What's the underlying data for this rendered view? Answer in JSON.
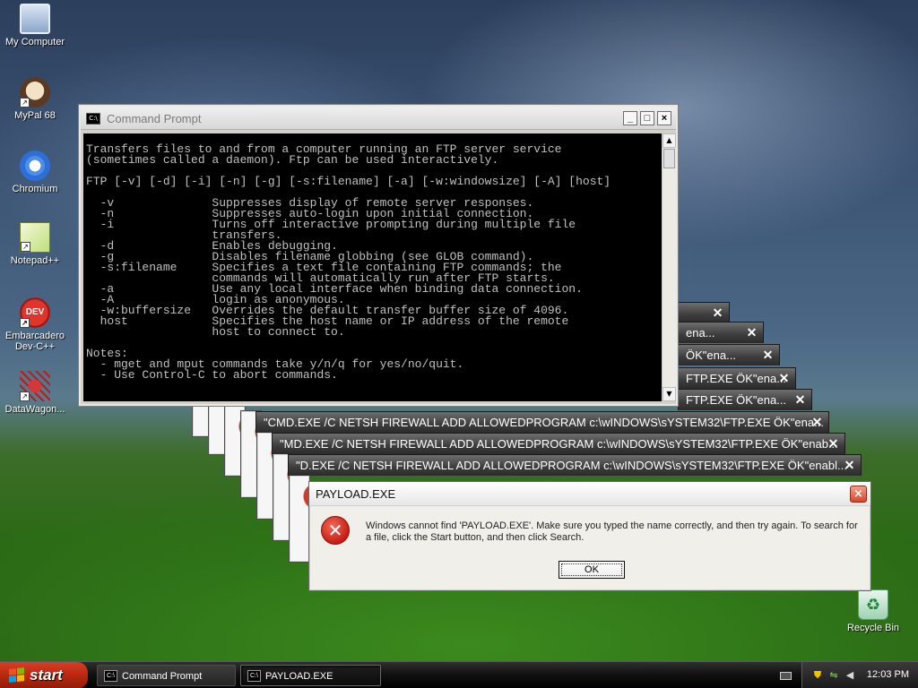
{
  "desktop": {
    "icons": [
      {
        "label": "My Computer"
      },
      {
        "label": "MyPal 68"
      },
      {
        "label": "Chromium"
      },
      {
        "label": "Notepad++"
      },
      {
        "label": "Embarcadero Dev-C++"
      },
      {
        "label": "DataWagon..."
      },
      {
        "label": "Recycle Bin"
      }
    ]
  },
  "cascade_windows": [
    {
      "title": ""
    },
    {
      "title": "ena..."
    },
    {
      "title": "ÖK\"ena..."
    },
    {
      "title": "FTP.EXE ÖK\"ena..."
    },
    {
      "title": "FTP.EXE ÖK\"ena..."
    },
    {
      "title": "\"CMD.EXE /C NETSH FIREWALL ADD ALLOWEDPROGRAM c:\\wINDOWS\\sYSTEM32\\FTP.EXE ÖK\"ena..."
    },
    {
      "title": "\"MD.EXE /C NETSH FIREWALL ADD ALLOWEDPROGRAM c:\\wINDOWS\\sYSTEM32\\FTP.EXE ÖK\"enab..."
    },
    {
      "title": "\"D.EXE /C NETSH FIREWALL ADD ALLOWEDPROGRAM c:\\wINDOWS\\sYSTEM32\\FTP.EXE ÖK\"enabl..."
    }
  ],
  "cmd": {
    "title": "Command Prompt",
    "icon_text": "C:\\",
    "min_label": "_",
    "max_label": "□",
    "close_label": "×",
    "console_text": "Transfers files to and from a computer running an FTP server service\n(sometimes called a daemon). Ftp can be used interactively.\n\nFTP [-v] [-d] [-i] [-n] [-g] [-s:filename] [-a] [-w:windowsize] [-A] [host]\n\n  -v              Suppresses display of remote server responses.\n  -n              Suppresses auto-login upon initial connection.\n  -i              Turns off interactive prompting during multiple file\n                  transfers.\n  -d              Enables debugging.\n  -g              Disables filename globbing (see GLOB command).\n  -s:filename     Specifies a text file containing FTP commands; the\n                  commands will automatically run after FTP starts.\n  -a              Use any local interface when binding data connection.\n  -A              login as anonymous.\n  -w:buffersize   Overrides the default transfer buffer size of 4096.\n  host            Specifies the host name or IP address of the remote\n                  host to connect to.\n\nNotes:\n  - mget and mput commands take y/n/q for yes/no/quit.\n  - Use Control-C to abort commands."
  },
  "payload": {
    "title": "PAYLOAD.EXE",
    "close_label": "×",
    "icon_text": "✕",
    "message": "Windows cannot find 'PAYLOAD.EXE'. Make sure you typed the name correctly, and then try again. To search for a file, click the Start button, and then click Search.",
    "ok_label": "OK"
  },
  "taskbar": {
    "start_label": "start",
    "buttons": [
      {
        "label": "Command Prompt",
        "icon_text": "C:\\"
      },
      {
        "label": "PAYLOAD.EXE",
        "icon_text": "C:\\"
      }
    ],
    "clock": "12:03 PM"
  },
  "colors": {
    "console_bg": "#000000",
    "console_fg": "#c0c0c0",
    "start_button": "#c0301a",
    "taskbar": "#1a1a1a"
  }
}
